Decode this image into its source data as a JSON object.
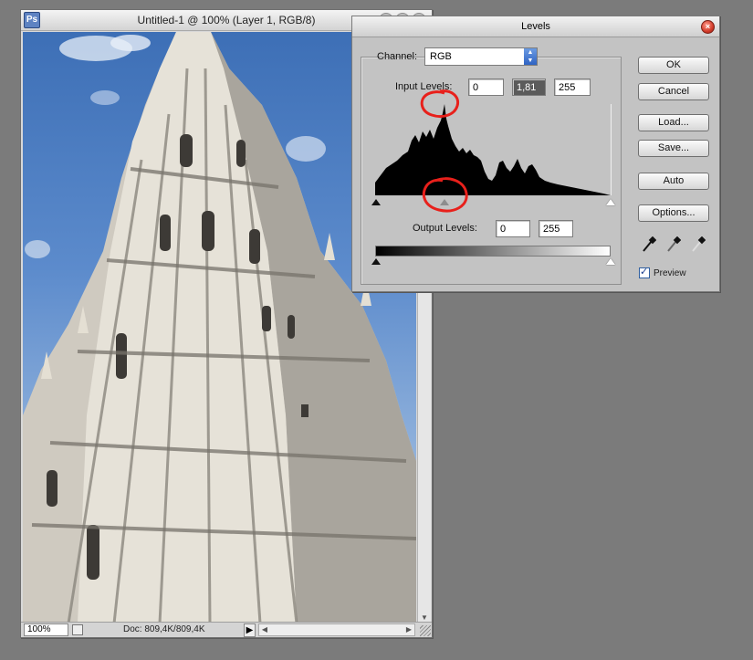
{
  "document": {
    "title": "Untitled-1 @ 100% (Layer 1, RGB/8)",
    "zoom": "100%",
    "doc_size": "Doc: 809,4K/809,4K",
    "app_icon_letter": "Ps"
  },
  "levels": {
    "title": "Levels",
    "channel_label": "Channel:",
    "channel_value": "RGB",
    "input_label": "Input Levels:",
    "input_black": "0",
    "input_gamma": "1,81",
    "input_white": "255",
    "output_label": "Output Levels:",
    "output_black": "0",
    "output_white": "255",
    "buttons": {
      "ok": "OK",
      "cancel": "Cancel",
      "load": "Load...",
      "save": "Save...",
      "auto": "Auto",
      "options": "Options..."
    },
    "preview_label": "Preview",
    "preview_checked": true,
    "annotation_color": "#e8201b"
  }
}
